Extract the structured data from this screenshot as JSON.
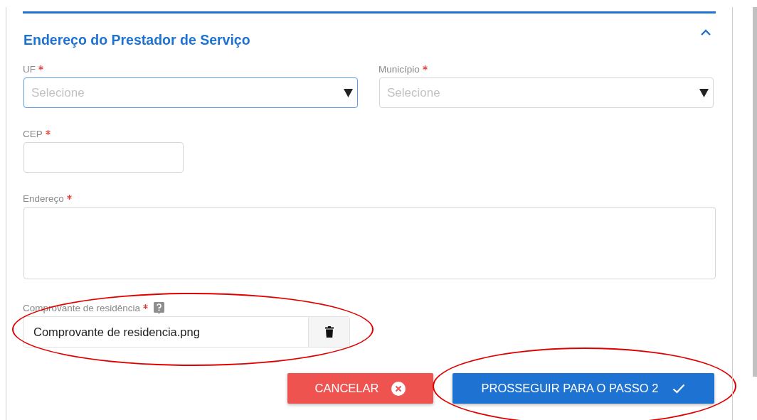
{
  "section": {
    "title": "Endereço do Prestador de Serviço",
    "expanded": true
  },
  "rows": [
    [
      {
        "kind": "select",
        "label": "UF",
        "required": true,
        "placeholder": "Selecione",
        "focused": true
      },
      {
        "kind": "select",
        "label": "Município",
        "required": true,
        "placeholder": "Selecione",
        "focused": false
      }
    ],
    [
      {
        "kind": "text",
        "label": "CEP",
        "required": true,
        "focused": false
      }
    ],
    [
      {
        "kind": "textarea",
        "label": "Endereço",
        "required": true,
        "focused": false
      }
    ],
    [
      {
        "kind": "file",
        "label": "Comprovante de residência",
        "required": true,
        "help": true,
        "value": "Comprovante de residencia.png",
        "circled": true
      }
    ]
  ],
  "buttons": [
    {
      "kind": "cancel",
      "label": "CANCELAR",
      "circled": false
    },
    {
      "kind": "proceed",
      "label": "PROSSEGUIR PARA O PASSO 2",
      "circled": true
    }
  ]
}
